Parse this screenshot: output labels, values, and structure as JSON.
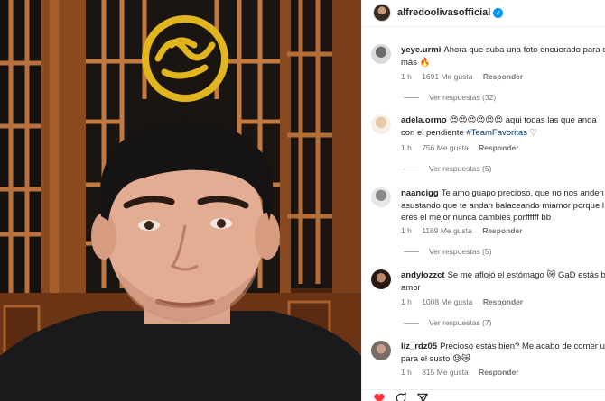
{
  "post": {
    "username": "alfredoolivasofficial",
    "verified_mark": "✓",
    "verified_icon": "verified-badge-icon"
  },
  "comments": [
    {
      "username": "yeye.urmi",
      "text_line1": "Ahora que suba una foto encuerado para co",
      "text_line2": "más 🔥",
      "time": "1 h",
      "likes": "1691 Me gusta",
      "reply": "Responder",
      "replies": "Ver respuestas (32)"
    },
    {
      "username": "adela.ormo",
      "text_line1": "😍😍😍😍😍😍 aqui todas las que anda",
      "text_line2_pre": "con el pendiente ",
      "hashtag": "#TeamFavoritas",
      "text_line2_post": " ♡",
      "time": "1 h",
      "likes": "756 Me gusta",
      "reply": "Responder",
      "replies": "Ver respuestas (5)"
    },
    {
      "username": "naancigg",
      "text_line1": "Te amo guapo precioso, que no nos anden",
      "text_line2": "asustando que te andan balaceando miamor porque l",
      "text_line3": "eres el mejor nunca cambies porffffff bb",
      "time": "1 h",
      "likes": "1189 Me gusta",
      "reply": "Responder",
      "replies": "Ver respuestas (5)"
    },
    {
      "username": "andylozzct",
      "text_line1": "Se me aflojó el estómago 😿 GaD estás bie",
      "text_line2": "amor",
      "time": "1 h",
      "likes": "1008 Me gusta",
      "reply": "Responder",
      "replies": "Ver respuestas (7)"
    },
    {
      "username": "liz_rdz05",
      "text_line1": "Precioso estás bien? Me acabo de comer un b",
      "text_line2": "para el susto 😓😿",
      "time": "1 h",
      "likes": "815 Me gusta",
      "reply": "Responder"
    }
  ],
  "actions": {
    "like_icon": "heart-icon",
    "comment_icon": "comment-icon",
    "share_icon": "share-icon",
    "like_color": "#ff3040"
  },
  "colors": {
    "link": "#00376b",
    "muted": "#737373",
    "verified": "#0095f6"
  }
}
